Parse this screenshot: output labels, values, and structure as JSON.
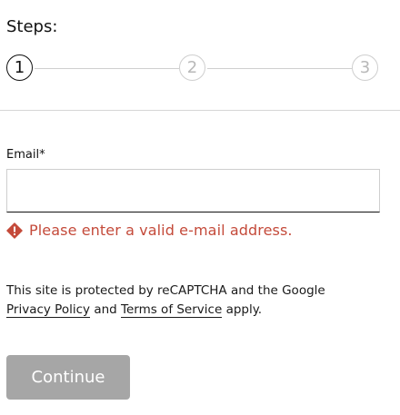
{
  "steps": {
    "title": "Steps:",
    "items": [
      {
        "number": "1",
        "state": "active"
      },
      {
        "number": "2",
        "state": "inactive"
      },
      {
        "number": "3",
        "state": "inactive"
      }
    ]
  },
  "form": {
    "email_label": "Email*",
    "email_value": "",
    "error_message": "Please enter a valid e-mail address.",
    "error_icon": "warning-diamond-icon"
  },
  "recaptcha": {
    "prefix": "This site is protected by reCAPTCHA and the Google",
    "privacy_link": "Privacy Policy",
    "conjunction": "and",
    "terms_link": "Terms of Service",
    "suffix": "apply."
  },
  "actions": {
    "continue_label": "Continue"
  },
  "colors": {
    "error": "#c44a3a",
    "button_disabled": "#a6a6a6",
    "step_inactive": "#cfcfcf"
  }
}
